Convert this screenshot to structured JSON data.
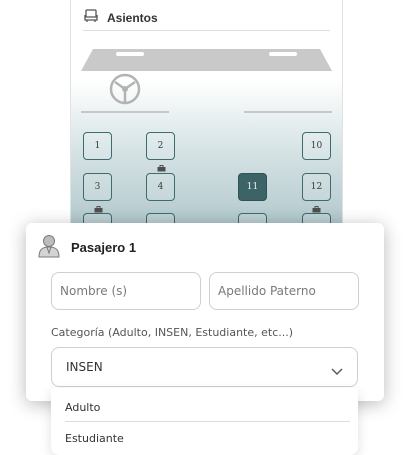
{
  "seat_panel": {
    "title": "Asientos",
    "seats": [
      {
        "label": "1",
        "selected": false
      },
      {
        "label": "2",
        "selected": false
      },
      {
        "label": "10",
        "selected": false
      },
      {
        "label": "3",
        "selected": false
      },
      {
        "label": "4",
        "selected": false
      },
      {
        "label": "11",
        "selected": true
      },
      {
        "label": "12",
        "selected": false
      }
    ]
  },
  "passenger": {
    "title": "Pasajero 1",
    "first_name_placeholder": "Nombre (s)",
    "last_name_placeholder": "Apellido Paterno",
    "category_label": "Categoría (Adulto, INSEN, Estudiante, etc...)",
    "category_value": "INSEN"
  },
  "dropdown": {
    "options": [
      "Adulto",
      "Estudiante"
    ]
  },
  "colors": {
    "seat_border": "#3f6b6e",
    "seat_selected": "#3c6366"
  }
}
